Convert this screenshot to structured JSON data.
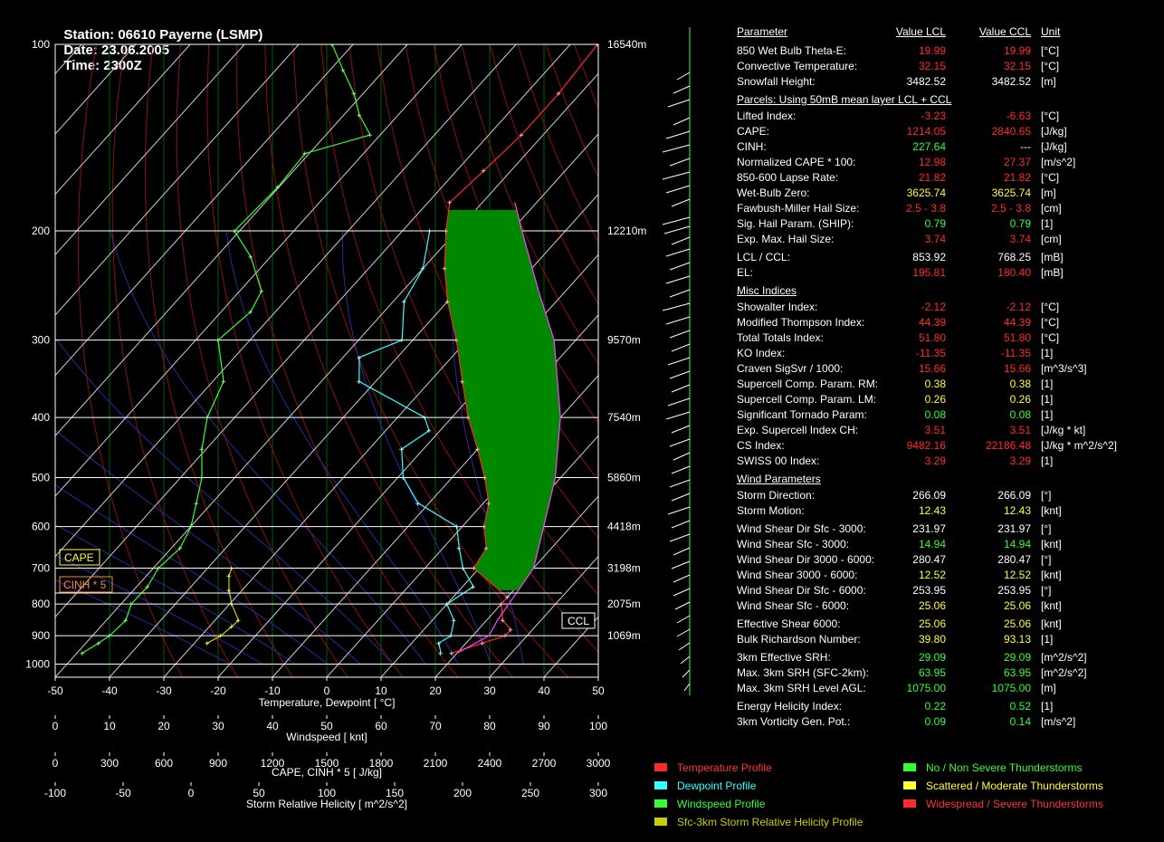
{
  "header": {
    "station": "Station: 06610 Payerne (LSMP)",
    "date": "Date: 23.06.2005",
    "time": "Time: 2300Z"
  },
  "colors": {
    "red": "#ff2a2a",
    "yellow": "#ffff33",
    "green": "#33ff33",
    "white": "#ffffff",
    "cyan": "#33ffff",
    "olive": "#cccc00",
    "cape_fill": "#008800"
  },
  "table": {
    "headers": {
      "param": "Parameter",
      "lcl": "Value LCL",
      "ccl": "Value CCL",
      "unit": "Unit"
    },
    "rows": [
      {
        "label": "850 Wet Bulb Theta-E:",
        "lcl": "19.99",
        "ccl": "19.99",
        "unit": "[°C]",
        "color": "red"
      },
      {
        "label": "Convective Temperature:",
        "lcl": "32.15",
        "ccl": "32.15",
        "unit": "[°C]",
        "color": "red"
      },
      {
        "label": "Snowfall Height:",
        "lcl": "3482.52",
        "ccl": "3482.52",
        "unit": "[m]",
        "color": "white"
      },
      {
        "section": "Parcels: Using 50mB mean layer LCL + CCL"
      },
      {
        "label": "Lifted Index:",
        "lcl": "-3.23",
        "ccl": "-6.63",
        "unit": "[°C]",
        "color": "red"
      },
      {
        "label": "CAPE:",
        "lcl": "1214.05",
        "ccl": "2840.65",
        "unit": "[J/kg]",
        "color": "red"
      },
      {
        "label": "CINH:",
        "lcl": "227.64",
        "ccl": "---",
        "unit": "[J/kg]",
        "color": "green",
        "ccl_color": "white"
      },
      {
        "label": "Normalized CAPE * 100:",
        "lcl": "12.98",
        "ccl": "27.37",
        "unit": "[m/s^2]",
        "color": "red"
      },
      {
        "label": "850-600 Lapse Rate:",
        "lcl": "21.82",
        "ccl": "21.82",
        "unit": "[°C]",
        "color": "red"
      },
      {
        "label": "Wet-Bulb Zero:",
        "lcl": "3625.74",
        "ccl": "3625.74",
        "unit": "[m]",
        "color": "yellow"
      },
      {
        "label": "Fawbush-Miller Hail Size:",
        "lcl": "2.5 - 3.8",
        "ccl": "2.5 - 3.8",
        "unit": "[cm]",
        "color": "red"
      },
      {
        "label": "Sig. Hail Param. (SHIP):",
        "lcl": "0.79",
        "ccl": "0.79",
        "unit": "[1]",
        "color": "green"
      },
      {
        "label": "Exp. Max. Hail Size:",
        "lcl": "3.74",
        "ccl": "3.74",
        "unit": "[cm]",
        "color": "red"
      },
      {
        "label": "LCL / CCL:",
        "lcl": "853.92",
        "ccl": "768.25",
        "unit": "[mB]",
        "color": "white"
      },
      {
        "label": "EL:",
        "lcl": "195.81",
        "ccl": "180.40",
        "unit": "[mB]",
        "color": "red"
      },
      {
        "section": "Misc Indices"
      },
      {
        "label": "Showalter Index:",
        "lcl": "-2.12",
        "ccl": "-2.12",
        "unit": "[°C]",
        "color": "red"
      },
      {
        "label": "Modified Thompson Index:",
        "lcl": "44.39",
        "ccl": "44.39",
        "unit": "[°C]",
        "color": "red"
      },
      {
        "label": "Total Totals Index:",
        "lcl": "51.80",
        "ccl": "51.80",
        "unit": "[°C]",
        "color": "red"
      },
      {
        "label": "KO Index:",
        "lcl": "-11.35",
        "ccl": "-11.35",
        "unit": "[1]",
        "color": "red"
      },
      {
        "label": "Craven SigSvr / 1000:",
        "lcl": "15.66",
        "ccl": "15.66",
        "unit": "[m^3/s^3]",
        "color": "red"
      },
      {
        "label": "Supercell Comp. Param. RM:",
        "lcl": "0.38",
        "ccl": "0.38",
        "unit": "[1]",
        "color": "yellow"
      },
      {
        "label": "Supercell Comp. Param. LM:",
        "lcl": "0.26",
        "ccl": "0.26",
        "unit": "[1]",
        "color": "yellow"
      },
      {
        "label": "Significant Tornado Param:",
        "lcl": "0.08",
        "ccl": "0.08",
        "unit": "[1]",
        "color": "green"
      },
      {
        "label": "Exp. Supercell Index CH:",
        "lcl": "3.51",
        "ccl": "3.51",
        "unit": "[J/kg * kt]",
        "color": "red"
      },
      {
        "label": "CS Index:",
        "lcl": "9482.16",
        "ccl": "22186.48",
        "unit": "[J/kg * m^2/s^2]",
        "color": "red"
      },
      {
        "label": "SWISS 00 Index:",
        "lcl": "3.29",
        "ccl": "3.29",
        "unit": "[1]",
        "color": "red"
      },
      {
        "section": "Wind Parameters"
      },
      {
        "label": "Storm Direction:",
        "lcl": "266.09",
        "ccl": "266.09",
        "unit": "[°]",
        "color": "white"
      },
      {
        "label": "Storm Motion:",
        "lcl": "12.43",
        "ccl": "12.43",
        "unit": "[knt]",
        "color": "yellow"
      },
      {
        "label": "Wind Shear Dir Sfc - 3000:",
        "lcl": "231.97",
        "ccl": "231.97",
        "unit": "[°]",
        "color": "white"
      },
      {
        "label": "Wind Shear Sfc - 3000:",
        "lcl": "14.94",
        "ccl": "14.94",
        "unit": "[knt]",
        "color": "green"
      },
      {
        "label": "Wind Shear Dir 3000 - 6000:",
        "lcl": "280.47",
        "ccl": "280.47",
        "unit": "[°]",
        "color": "white"
      },
      {
        "label": "Wind Shear 3000 - 6000:",
        "lcl": "12.52",
        "ccl": "12.52",
        "unit": "[knt]",
        "color": "yellow"
      },
      {
        "label": "Wind Shear Dir Sfc - 6000:",
        "lcl": "253.95",
        "ccl": "253.95",
        "unit": "[°]",
        "color": "white"
      },
      {
        "label": "Wind Shear Sfc - 6000:",
        "lcl": "25.06",
        "ccl": "25.06",
        "unit": "[knt]",
        "color": "yellow"
      },
      {
        "label": "Effective Shear 6000:",
        "lcl": "25.06",
        "ccl": "25.06",
        "unit": "[knt]",
        "color": "yellow"
      },
      {
        "label": "Bulk Richardson Number:",
        "lcl": "39.80",
        "ccl": "93.13",
        "unit": "[1]",
        "color": "yellow"
      },
      {
        "label": "3km Effective SRH:",
        "lcl": "29.09",
        "ccl": "29.09",
        "unit": "[m^2/s^2]",
        "color": "green"
      },
      {
        "label": "Max. 3km SRH (SFC-2km):",
        "lcl": "63.95",
        "ccl": "63.95",
        "unit": "[m^2/s^2]",
        "color": "green"
      },
      {
        "label": "Max. 3km SRH Level AGL:",
        "lcl": "1075.00",
        "ccl": "1075.00",
        "unit": "[m]",
        "color": "green"
      },
      {
        "label": "Energy Helicity Index:",
        "lcl": "0.22",
        "ccl": "0.52",
        "unit": "[1]",
        "color": "green"
      },
      {
        "label": "3km Vorticity Gen. Pot.:",
        "lcl": "0.09",
        "ccl": "0.14",
        "unit": "[m/s^2]",
        "color": "green"
      }
    ]
  },
  "legend": {
    "left": [
      {
        "label": "Temperature Profile",
        "color": "#ff2a2a",
        "text_color": "#ff3333"
      },
      {
        "label": "Dewpoint Profile",
        "color": "#33ffff",
        "text_color": "#33ffff"
      },
      {
        "label": "Windspeed Profile",
        "color": "#33ff33",
        "text_color": "#33ff33"
      },
      {
        "label": "Sfc-3km Storm Relative Helicity Profile",
        "color": "#cccc00",
        "text_color": "#cccc00"
      }
    ],
    "right": [
      {
        "label": "No / Non Severe Thunderstorms",
        "color": "#33ff33",
        "text_color": "#33ff33"
      },
      {
        "label": "Scattered / Moderate Thunderstorms",
        "color": "#ffff33",
        "text_color": "#ffff33"
      },
      {
        "label": "Widespread / Severe Thunderstorms",
        "color": "#ff2a2a",
        "text_color": "#ff3333"
      }
    ]
  },
  "chart_data": {
    "type": "skew-t",
    "y_pressure_ticks": [
      "100",
      "200",
      "300",
      "400",
      "500",
      "600",
      "700",
      "800",
      "900",
      "1000"
    ],
    "height_labels": [
      {
        "p": 100,
        "label": "16540m"
      },
      {
        "p": 200,
        "label": "12210m"
      },
      {
        "p": 300,
        "label": "9570m"
      },
      {
        "p": 400,
        "label": "7540m"
      },
      {
        "p": 500,
        "label": "5860m"
      },
      {
        "p": 600,
        "label": "4418m"
      },
      {
        "p": 700,
        "label": "3198m"
      },
      {
        "p": 800,
        "label": "2075m"
      },
      {
        "p": 900,
        "label": "1069m"
      }
    ],
    "xlim": [
      -50,
      50
    ],
    "ylim_hpa": [
      1050,
      100
    ],
    "temperature_ticks": [
      "-50",
      "-40",
      "-30",
      "-20",
      "-10",
      "0",
      "10",
      "20",
      "30",
      "40",
      "50"
    ],
    "temperature_label": "Temperature, Dewpoint  [ °C]",
    "windspeed_ticks": [
      "0",
      "10",
      "20",
      "30",
      "40",
      "50",
      "60",
      "70",
      "80",
      "90",
      "100"
    ],
    "windspeed_label": "Windspeed  [ knt]",
    "cape_ticks": [
      "0",
      "300",
      "600",
      "900",
      "1200",
      "1500",
      "1800",
      "2100",
      "2400",
      "2700",
      "3000"
    ],
    "cape_label": "CAPE, CINH * 5  [ J/kg]",
    "srh_ticks": [
      "-100",
      "-50",
      "0",
      "50",
      "100",
      "150",
      "200",
      "250",
      "300"
    ],
    "srh_label": "Storm Relative Helicity  [ m^2/s^2]",
    "box_labels": {
      "cape": "CAPE",
      "cinh": "CINH * 5",
      "ccl": "CCL"
    },
    "ccl_pressure": 768,
    "temperature": [
      [
        960,
        19
      ],
      [
        925,
        23
      ],
      [
        900,
        26
      ],
      [
        880,
        26
      ],
      [
        850,
        23
      ],
      [
        800,
        20
      ],
      [
        780,
        20
      ],
      [
        700,
        9
      ],
      [
        650,
        8
      ],
      [
        600,
        4
      ],
      [
        550,
        1
      ],
      [
        500,
        -4
      ],
      [
        450,
        -10
      ],
      [
        400,
        -17
      ],
      [
        350,
        -24
      ],
      [
        300,
        -32
      ],
      [
        260,
        -40
      ],
      [
        230,
        -46
      ],
      [
        200,
        -52
      ],
      [
        180,
        -56
      ],
      [
        160,
        -55
      ],
      [
        140,
        -54
      ],
      [
        120,
        -54
      ],
      [
        100,
        -55
      ]
    ],
    "dewpoint": [
      [
        960,
        17
      ],
      [
        925,
        15
      ],
      [
        900,
        16
      ],
      [
        850,
        14
      ],
      [
        800,
        10
      ],
      [
        750,
        12
      ],
      [
        700,
        7
      ],
      [
        650,
        3
      ],
      [
        600,
        -1
      ],
      [
        550,
        -12
      ],
      [
        500,
        -19
      ],
      [
        450,
        -24
      ],
      [
        420,
        -22
      ],
      [
        400,
        -25
      ],
      [
        350,
        -43
      ],
      [
        320,
        -47
      ],
      [
        300,
        -42
      ],
      [
        260,
        -48
      ],
      [
        230,
        -50
      ],
      [
        200,
        -55
      ]
    ],
    "parcel": [
      [
        960,
        20
      ],
      [
        900,
        23
      ],
      [
        850,
        22
      ],
      [
        770,
        21
      ],
      [
        700,
        20
      ],
      [
        600,
        15
      ],
      [
        500,
        9
      ],
      [
        400,
        0
      ],
      [
        300,
        -14
      ],
      [
        250,
        -25
      ],
      [
        200,
        -38
      ],
      [
        180,
        -44
      ]
    ],
    "windspeed_knt": [
      [
        960,
        5
      ],
      [
        925,
        8
      ],
      [
        900,
        10
      ],
      [
        850,
        13
      ],
      [
        800,
        14
      ],
      [
        750,
        17
      ],
      [
        700,
        19
      ],
      [
        650,
        23
      ],
      [
        600,
        25
      ],
      [
        550,
        26
      ],
      [
        500,
        27
      ],
      [
        450,
        27
      ],
      [
        400,
        28
      ],
      [
        350,
        31
      ],
      [
        300,
        30
      ],
      [
        270,
        36
      ],
      [
        250,
        38
      ],
      [
        220,
        36
      ],
      [
        200,
        33
      ],
      [
        170,
        41
      ],
      [
        150,
        46
      ],
      [
        140,
        58
      ],
      [
        130,
        56
      ],
      [
        120,
        55
      ],
      [
        110,
        53
      ],
      [
        100,
        51
      ]
    ],
    "srh_profile": [
      [
        925,
        12
      ],
      [
        900,
        22
      ],
      [
        870,
        30
      ],
      [
        850,
        35
      ],
      [
        800,
        30
      ],
      [
        760,
        28
      ],
      [
        720,
        28
      ],
      [
        700,
        30
      ]
    ],
    "wind_barbs_note": "wind barbs along right of chart"
  }
}
